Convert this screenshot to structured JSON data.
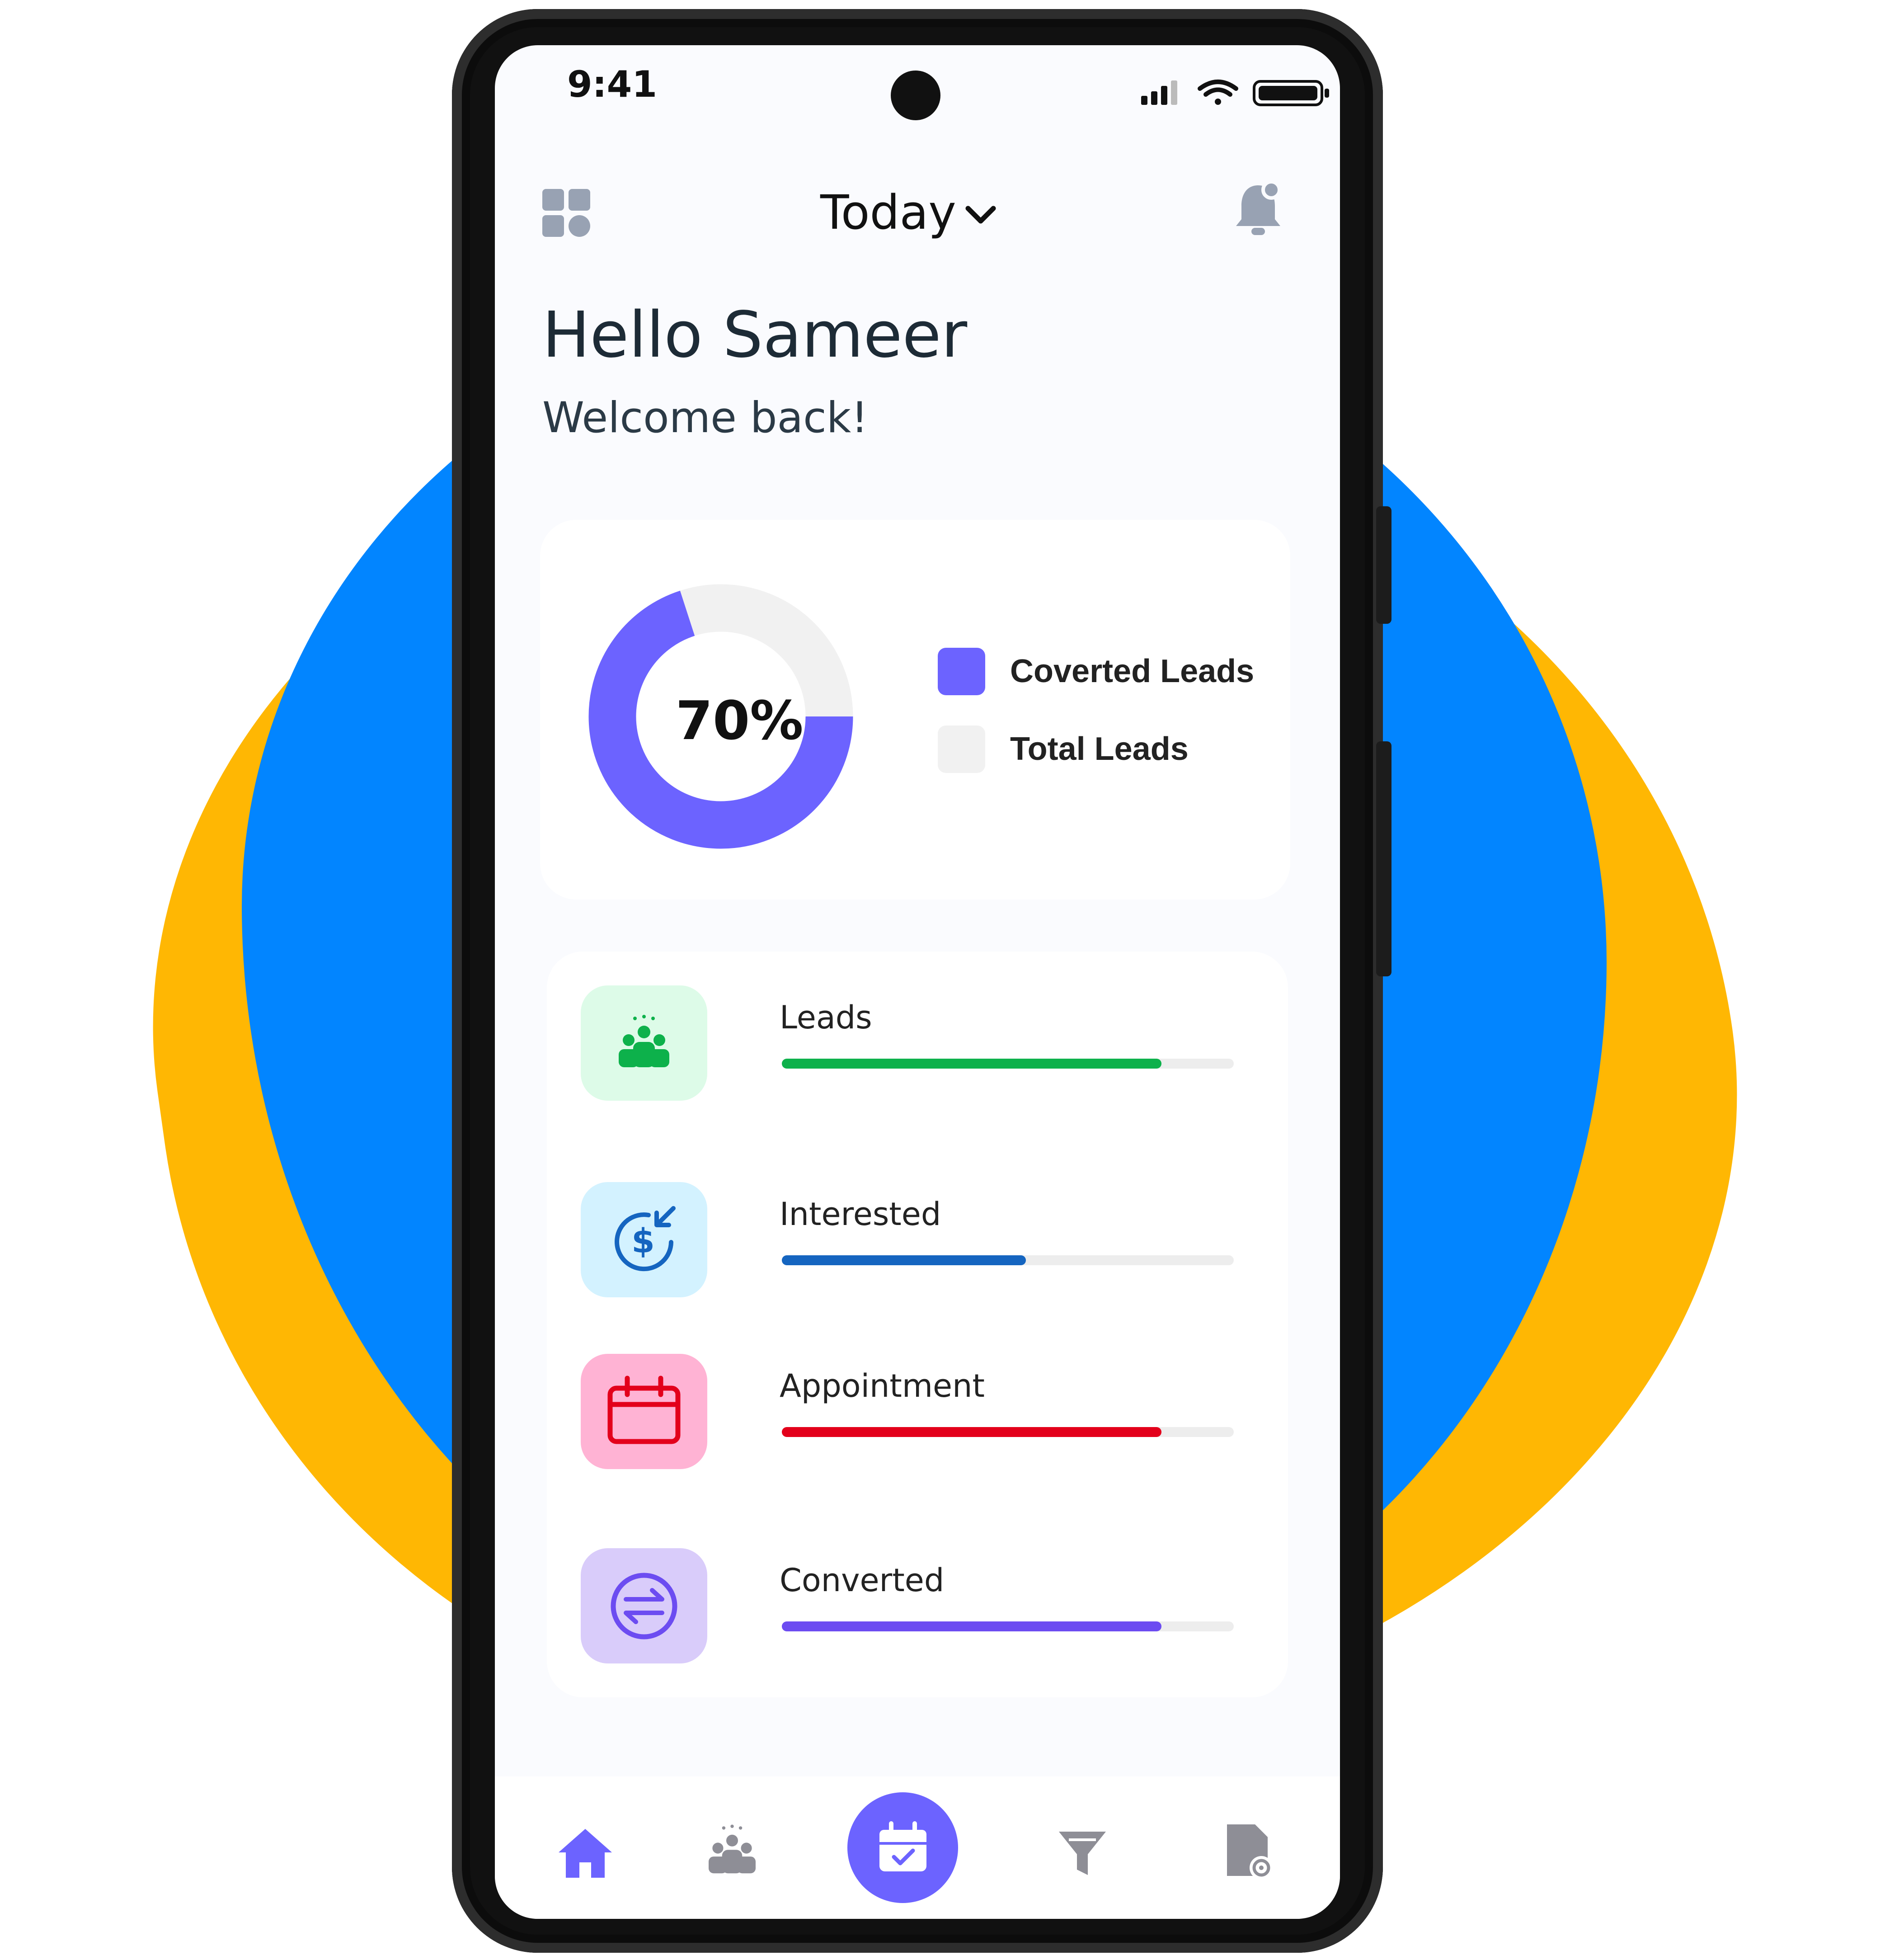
{
  "status_bar": {
    "time": "9:41"
  },
  "header": {
    "period_label": "Today",
    "chevron": "chevron-down-icon",
    "left_icon": "grid-icon",
    "right_icon": "bell-icon"
  },
  "greeting": {
    "title": "Hello Sameer",
    "subtitle": "Welcome back!"
  },
  "summary": {
    "percent_label": "70%",
    "converted_fraction": 0.7,
    "legend": [
      {
        "label": "Coverted Leads",
        "color": "#6C63FF"
      },
      {
        "label": "Total Leads",
        "color": "#F1F1F1"
      }
    ]
  },
  "stats": [
    {
      "label": "Leads",
      "progress": 0.84,
      "color": "#0DB14B",
      "bg": "#DDFBE8",
      "icon": "people-group-icon"
    },
    {
      "label": "Interested",
      "progress": 0.54,
      "color": "#1565C0",
      "bg": "#D3F2FF",
      "icon": "dollar-return-icon"
    },
    {
      "label": "Appointment",
      "progress": 0.84,
      "color": "#E3001B",
      "bg": "#FFB3D4",
      "icon": "calendar-icon"
    },
    {
      "label": "Converted",
      "progress": 0.84,
      "color": "#6C4CF1",
      "bg": "#D9CCFA",
      "icon": "exchange-icon"
    }
  ],
  "nav": [
    "home-icon",
    "people-icon",
    "calendar-check-icon",
    "filter-icon",
    "document-settings-icon"
  ],
  "colors": {
    "accent": "#6C63FF",
    "backdrop_blue": "#0285FF",
    "backdrop_yellow": "#FFB703"
  }
}
